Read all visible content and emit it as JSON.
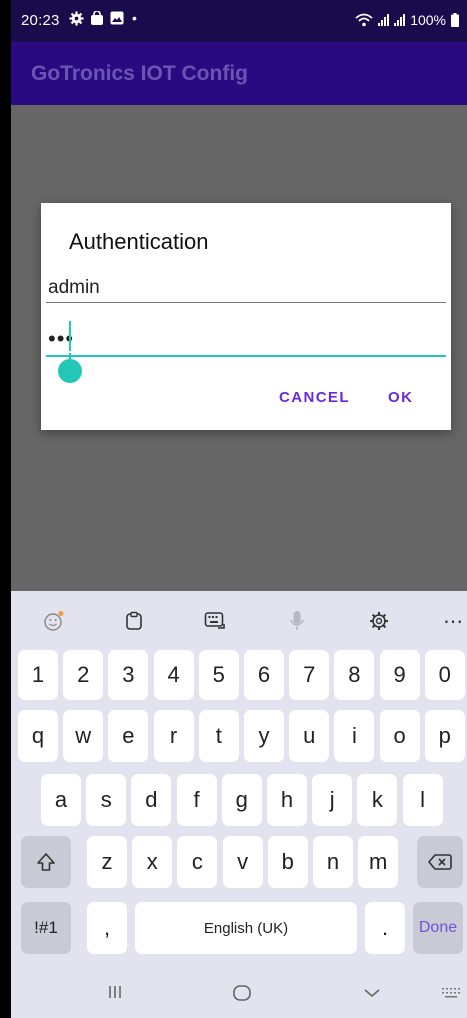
{
  "status_bar": {
    "time": "20:23",
    "battery": "100%"
  },
  "app_bar": {
    "title": "GoTronics IOT Config"
  },
  "dialog": {
    "title": "Authentication",
    "username_value": "admin",
    "password_value": "•••",
    "cancel_label": "CANCEL",
    "ok_label": "OK",
    "accent_color": "#22c7b8",
    "button_color": "#6a2bd6"
  },
  "keyboard": {
    "toolbar_icons": [
      "emoji-icon",
      "clipboard-icon",
      "keyboard-icon",
      "mic-icon",
      "settings-icon",
      "more-icon"
    ],
    "row_numbers": [
      "1",
      "2",
      "3",
      "4",
      "5",
      "6",
      "7",
      "8",
      "9",
      "0"
    ],
    "row_q": [
      "q",
      "w",
      "e",
      "r",
      "t",
      "y",
      "u",
      "i",
      "o",
      "p"
    ],
    "row_a": [
      "a",
      "s",
      "d",
      "f",
      "g",
      "h",
      "j",
      "k",
      "l"
    ],
    "row_z": [
      "z",
      "x",
      "c",
      "v",
      "b",
      "n",
      "m"
    ],
    "symbols_label": "!#1",
    "comma_label": ",",
    "space_label": "English (UK)",
    "period_label": ".",
    "done_label": "Done"
  },
  "colors": {
    "status_bar_bg": "#1a0b4d",
    "app_bar_bg": "#2a0a80",
    "app_title": "#6a55b4",
    "keyboard_bg": "#e2e3ee"
  }
}
